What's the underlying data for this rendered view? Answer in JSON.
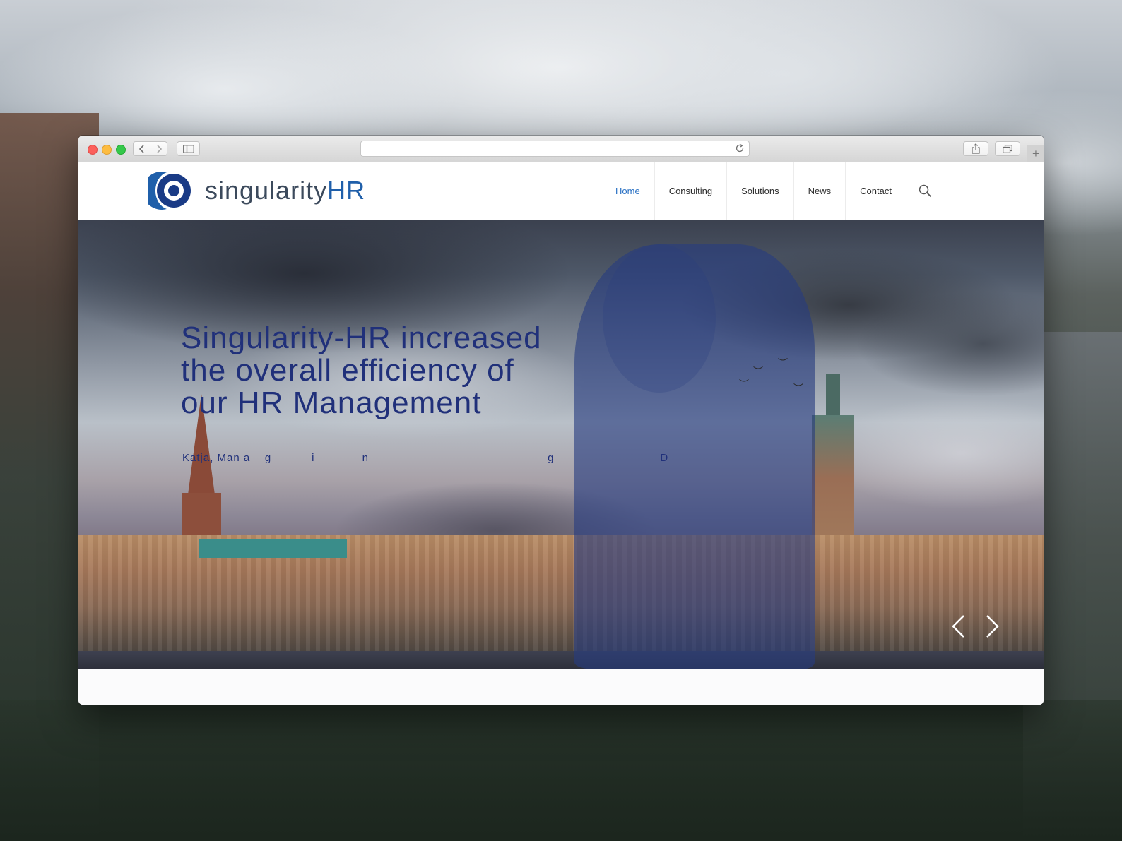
{
  "browser": {
    "window_controls": [
      "close",
      "minimize",
      "zoom"
    ],
    "back_icon": "chevron-left-icon",
    "forward_icon": "chevron-right-icon",
    "sidebar_icon": "sidebar-icon",
    "address_value": "",
    "reload_icon": "reload-icon",
    "share_icon": "share-icon",
    "tabs_icon": "tabs-icon",
    "new_tab_label": "+"
  },
  "site": {
    "logo": {
      "text_main": "singularity",
      "text_accent": "HR",
      "mark_color": "#1a3b86",
      "accent_color": "#1f5faa"
    },
    "nav": [
      {
        "label": "Home",
        "active": true
      },
      {
        "label": "Consulting",
        "active": false
      },
      {
        "label": "Solutions",
        "active": false
      },
      {
        "label": "News",
        "active": false
      },
      {
        "label": "Contact",
        "active": false
      }
    ],
    "search_icon": "search-icon"
  },
  "hero": {
    "heading": "Singularity-HR increased the overall efficiency of our HR Management",
    "caption": "Katja, Man a    g           i             n                                                 g                             D",
    "prev_icon": "chevron-left-icon",
    "next_icon": "chevron-right-icon",
    "text_color": "#20307a"
  }
}
